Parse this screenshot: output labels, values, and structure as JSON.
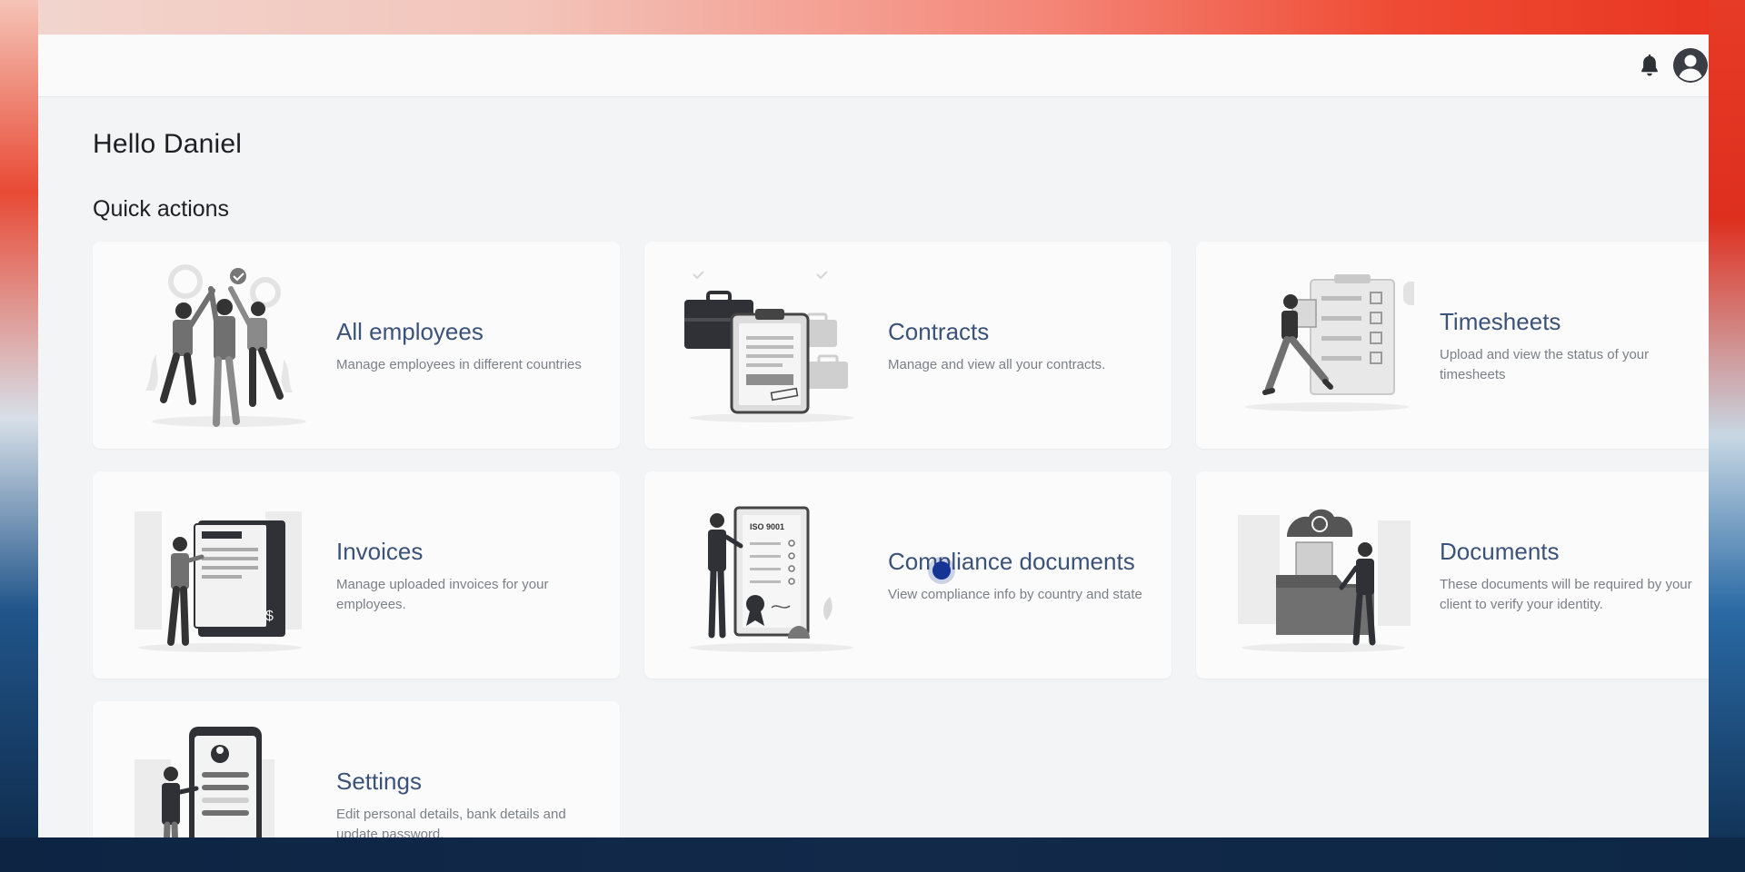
{
  "header": {
    "icons": [
      "bell-icon",
      "user-avatar-icon"
    ]
  },
  "greeting": "Hello Daniel",
  "section_title": "Quick actions",
  "cards": [
    {
      "title": "All employees",
      "description": "Manage employees in different countries",
      "icon": "team-high-five-illustration"
    },
    {
      "title": "Contracts",
      "description": "Manage and view all your contracts.",
      "icon": "contract-clipboard-illustration"
    },
    {
      "title": "Timesheets",
      "description": "Upload and view the status of your timesheets",
      "icon": "timesheet-checklist-illustration"
    },
    {
      "title": "Invoices",
      "description": "Manage uploaded invoices for your employees.",
      "icon": "invoice-document-illustration"
    },
    {
      "title": "Compliance documents",
      "description": "View compliance info by country and state",
      "icon": "certificate-illustration",
      "badge_text": "ISO 9001"
    },
    {
      "title": "Documents",
      "description": "These documents will be required by your client to verify your identity.",
      "icon": "cloud-folder-illustration"
    },
    {
      "title": "Settings",
      "description": "Edit personal details, bank details and update password.",
      "icon": "phone-profile-illustration"
    }
  ],
  "colors": {
    "title_accent": "#3b5279",
    "description_text": "#7b7f87",
    "cursor": "#153494",
    "app_background": "#f3f4f6"
  }
}
